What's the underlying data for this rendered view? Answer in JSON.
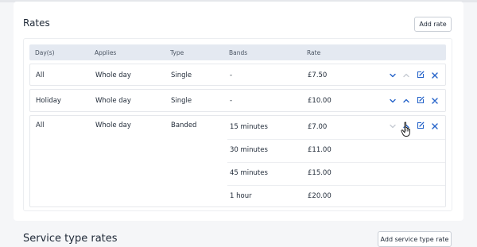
{
  "rates": {
    "title": "Rates",
    "add_button": "Add rate",
    "columns": [
      "Day(s)",
      "Applies",
      "Type",
      "Bands",
      "Rate"
    ],
    "rows": [
      {
        "days": "All",
        "applies": "Whole day",
        "type": "Single",
        "bands": [
          "-"
        ],
        "rates": [
          "£7.50"
        ]
      },
      {
        "days": "Holiday",
        "applies": "Whole day",
        "type": "Single",
        "bands": [
          "-"
        ],
        "rates": [
          "£10.00"
        ]
      },
      {
        "days": "All",
        "applies": "Whole day",
        "type": "Banded",
        "bands": [
          "15 minutes",
          "30 minutes",
          "45 minutes",
          "1 hour"
        ],
        "rates": [
          "£7.00",
          "£11.00",
          "£15.00",
          "£20.00"
        ]
      }
    ]
  },
  "service_type_rates": {
    "title": "Service type rates",
    "add_button": "Add service type rate"
  },
  "colors": {
    "action_blue": "#2563c9",
    "action_muted": "#c7cbd3",
    "header_bg": "#e4e9f1"
  },
  "icons": [
    "chevron-down-icon",
    "chevron-up-icon",
    "edit-icon",
    "close-icon",
    "hand-pointer-icon"
  ]
}
